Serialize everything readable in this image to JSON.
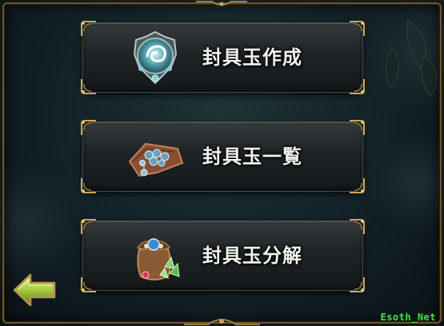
{
  "menu": {
    "items": [
      {
        "label": "封具玉作成",
        "icon": "jewel-crest-icon"
      },
      {
        "label": "封具玉一覧",
        "icon": "gem-cloth-icon"
      },
      {
        "label": "封具玉分解",
        "icon": "material-pouch-icon"
      }
    ]
  },
  "navigation": {
    "back_icon": "back-arrow-icon"
  },
  "watermark": {
    "text": "Esoth_Net"
  },
  "colors": {
    "background": "#14242a",
    "button_fill": "#1f2426",
    "frame_gold": "#b89550",
    "label_text": "#f2f2ee",
    "back_arrow": "#a8c840",
    "watermark": "#3ee04a"
  }
}
